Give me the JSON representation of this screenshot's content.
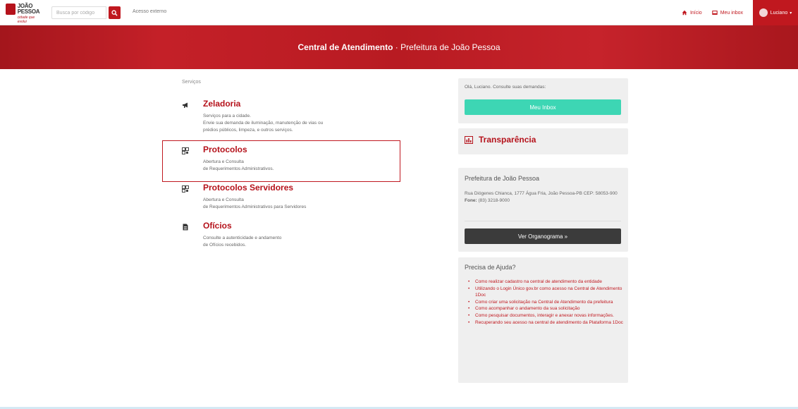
{
  "header": {
    "logo": {
      "line1": "JOÃO",
      "line2": "PESSOA",
      "tagline": "cidade que evolui"
    },
    "search": {
      "placeholder": "Busca por código"
    },
    "external_link": "Acesso externo",
    "nav": {
      "home": "Início",
      "inbox": "Meu inbox",
      "user": "Luciano"
    }
  },
  "banner": {
    "title_bold": "Central de Atendimento",
    "separator": " · ",
    "subtitle": "Prefeitura de João Pessoa"
  },
  "services": {
    "label": "Serviços",
    "items": [
      {
        "icon": "megaphone-icon",
        "title": "Zeladoria",
        "desc": [
          "Serviços para a cidade.",
          "Envie sua demanda de iluminação, manutenção de vias ou",
          "prédios públicos, limpeza, e outros serviços."
        ]
      },
      {
        "icon": "qrcode-icon",
        "title": "Protocolos",
        "desc": [
          "Abertura e Consulta",
          "de Requerimentos Administrativos."
        ]
      },
      {
        "icon": "qrcode-icon",
        "title": "Protocolos Servidores",
        "desc": [
          "Abertura e Consulta",
          "de Requerimentos Administrativos para Servidores"
        ]
      },
      {
        "icon": "document-icon",
        "title": "Ofícios",
        "desc": [
          "Consulte a autenticidade e andamento",
          "de Ofícios recebidos."
        ]
      }
    ]
  },
  "sidebar": {
    "greeting": "Olá, Luciano. Consulte suas demandas:",
    "inbox_button": "Meu Inbox",
    "transparency": "Transparência",
    "org": {
      "name": "Prefeitura de João Pessoa",
      "address": "Rua Diógenes Chianca, 1777 Água Fria, João Pessoa-PB CEP: 58053-900",
      "phone_label": "Fone:",
      "phone": "(83) 3218-9000",
      "button": "Ver Organograma »"
    },
    "help": {
      "title": "Precisa de Ajuda?",
      "links": [
        "Como realizar cadastro na central de atendimento da entidade",
        "Utilizando o Login Único gov.br como acesso na Central de Atendimento 1Doc",
        "Como criar uma solicitação na Central de Atendimento da prefeitura",
        "Como acompanhar o andamento da sua solicitação",
        "Como pesquisar documentos, interagir e anexar novas informações.",
        "Recuperando seu acesso na central de atendimento da Plataforma 1Doc"
      ]
    }
  },
  "colors": {
    "brand_red": "#c0181f",
    "inbox_teal": "#3dd6b4",
    "dark_button": "#3b3b3b",
    "panel_bg": "#efefef"
  }
}
